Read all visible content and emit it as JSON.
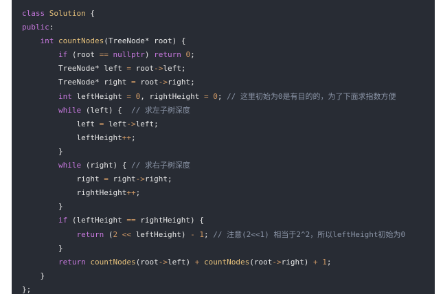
{
  "editor": {
    "lines": [
      [
        {
          "t": "class ",
          "c": "kw"
        },
        {
          "t": "Solution",
          "c": "type"
        },
        {
          "t": " {",
          "c": "punc"
        }
      ],
      [
        {
          "t": "public",
          "c": "kw"
        },
        {
          "t": ":",
          "c": "punc"
        }
      ],
      [
        {
          "t": "    ",
          "c": "plain"
        },
        {
          "t": "int",
          "c": "kw"
        },
        {
          "t": " ",
          "c": "plain"
        },
        {
          "t": "countNodes",
          "c": "fn"
        },
        {
          "t": "(TreeNode* root) {",
          "c": "plain"
        }
      ],
      [
        {
          "t": "        ",
          "c": "plain"
        },
        {
          "t": "if",
          "c": "kw"
        },
        {
          "t": " (root ",
          "c": "plain"
        },
        {
          "t": "==",
          "c": "op"
        },
        {
          "t": " ",
          "c": "plain"
        },
        {
          "t": "nullptr",
          "c": "kw2"
        },
        {
          "t": ") ",
          "c": "plain"
        },
        {
          "t": "return",
          "c": "kw"
        },
        {
          "t": " ",
          "c": "plain"
        },
        {
          "t": "0",
          "c": "num"
        },
        {
          "t": ";",
          "c": "punc"
        }
      ],
      [
        {
          "t": "        TreeNode* left ",
          "c": "plain"
        },
        {
          "t": "=",
          "c": "op"
        },
        {
          "t": " root",
          "c": "plain"
        },
        {
          "t": "->",
          "c": "op"
        },
        {
          "t": "left;",
          "c": "plain"
        }
      ],
      [
        {
          "t": "        TreeNode* right ",
          "c": "plain"
        },
        {
          "t": "=",
          "c": "op"
        },
        {
          "t": " root",
          "c": "plain"
        },
        {
          "t": "->",
          "c": "op"
        },
        {
          "t": "right;",
          "c": "plain"
        }
      ],
      [
        {
          "t": "        ",
          "c": "plain"
        },
        {
          "t": "int",
          "c": "kw"
        },
        {
          "t": " leftHeight ",
          "c": "plain"
        },
        {
          "t": "=",
          "c": "op"
        },
        {
          "t": " ",
          "c": "plain"
        },
        {
          "t": "0",
          "c": "num"
        },
        {
          "t": ", rightHeight ",
          "c": "plain"
        },
        {
          "t": "=",
          "c": "op"
        },
        {
          "t": " ",
          "c": "plain"
        },
        {
          "t": "0",
          "c": "num"
        },
        {
          "t": "; ",
          "c": "plain"
        },
        {
          "t": "// 这里初始为0是有目的的，为了下面求指数方便",
          "c": "comment"
        }
      ],
      [
        {
          "t": "        ",
          "c": "plain"
        },
        {
          "t": "while",
          "c": "kw"
        },
        {
          "t": " (left) {  ",
          "c": "plain"
        },
        {
          "t": "// 求左子树深度",
          "c": "comment"
        }
      ],
      [
        {
          "t": "            left ",
          "c": "plain"
        },
        {
          "t": "=",
          "c": "op"
        },
        {
          "t": " left",
          "c": "plain"
        },
        {
          "t": "->",
          "c": "op"
        },
        {
          "t": "left;",
          "c": "plain"
        }
      ],
      [
        {
          "t": "            leftHeight",
          "c": "plain"
        },
        {
          "t": "++",
          "c": "op"
        },
        {
          "t": ";",
          "c": "punc"
        }
      ],
      [
        {
          "t": "        }",
          "c": "plain"
        }
      ],
      [
        {
          "t": "        ",
          "c": "plain"
        },
        {
          "t": "while",
          "c": "kw"
        },
        {
          "t": " (right) { ",
          "c": "plain"
        },
        {
          "t": "// 求右子树深度",
          "c": "comment"
        }
      ],
      [
        {
          "t": "            right ",
          "c": "plain"
        },
        {
          "t": "=",
          "c": "op"
        },
        {
          "t": " right",
          "c": "plain"
        },
        {
          "t": "->",
          "c": "op"
        },
        {
          "t": "right;",
          "c": "plain"
        }
      ],
      [
        {
          "t": "            rightHeight",
          "c": "plain"
        },
        {
          "t": "++",
          "c": "op"
        },
        {
          "t": ";",
          "c": "punc"
        }
      ],
      [
        {
          "t": "        }",
          "c": "plain"
        }
      ],
      [
        {
          "t": "        ",
          "c": "plain"
        },
        {
          "t": "if",
          "c": "kw"
        },
        {
          "t": " (leftHeight ",
          "c": "plain"
        },
        {
          "t": "==",
          "c": "op"
        },
        {
          "t": " rightHeight) {",
          "c": "plain"
        }
      ],
      [
        {
          "t": "            ",
          "c": "plain"
        },
        {
          "t": "return",
          "c": "kw"
        },
        {
          "t": " (",
          "c": "plain"
        },
        {
          "t": "2",
          "c": "num"
        },
        {
          "t": " ",
          "c": "plain"
        },
        {
          "t": "<<",
          "c": "op"
        },
        {
          "t": " leftHeight) ",
          "c": "plain"
        },
        {
          "t": "-",
          "c": "op"
        },
        {
          "t": " ",
          "c": "plain"
        },
        {
          "t": "1",
          "c": "num"
        },
        {
          "t": "; ",
          "c": "plain"
        },
        {
          "t": "// 注意(2<<1) 相当于2^2，所以leftHeight初始为0",
          "c": "comment"
        }
      ],
      [
        {
          "t": "        }",
          "c": "plain"
        }
      ],
      [
        {
          "t": "        ",
          "c": "plain"
        },
        {
          "t": "return",
          "c": "kw"
        },
        {
          "t": " ",
          "c": "plain"
        },
        {
          "t": "countNodes",
          "c": "fn"
        },
        {
          "t": "(root",
          "c": "plain"
        },
        {
          "t": "->",
          "c": "op"
        },
        {
          "t": "left) ",
          "c": "plain"
        },
        {
          "t": "+",
          "c": "op"
        },
        {
          "t": " ",
          "c": "plain"
        },
        {
          "t": "countNodes",
          "c": "fn"
        },
        {
          "t": "(root",
          "c": "plain"
        },
        {
          "t": "->",
          "c": "op"
        },
        {
          "t": "right) ",
          "c": "plain"
        },
        {
          "t": "+",
          "c": "op"
        },
        {
          "t": " ",
          "c": "plain"
        },
        {
          "t": "1",
          "c": "num"
        },
        {
          "t": ";",
          "c": "punc"
        }
      ],
      [
        {
          "t": "    }",
          "c": "plain"
        }
      ],
      [
        {
          "t": "};",
          "c": "plain"
        }
      ]
    ]
  },
  "colors": {
    "background": "#282c34",
    "keyword": "#c678dd",
    "type": "#e5c07b",
    "function": "#e5c07b",
    "number": "#d19a66",
    "operator": "#d19a66",
    "text": "#e6e6e6",
    "comment": "#8b95a7"
  }
}
